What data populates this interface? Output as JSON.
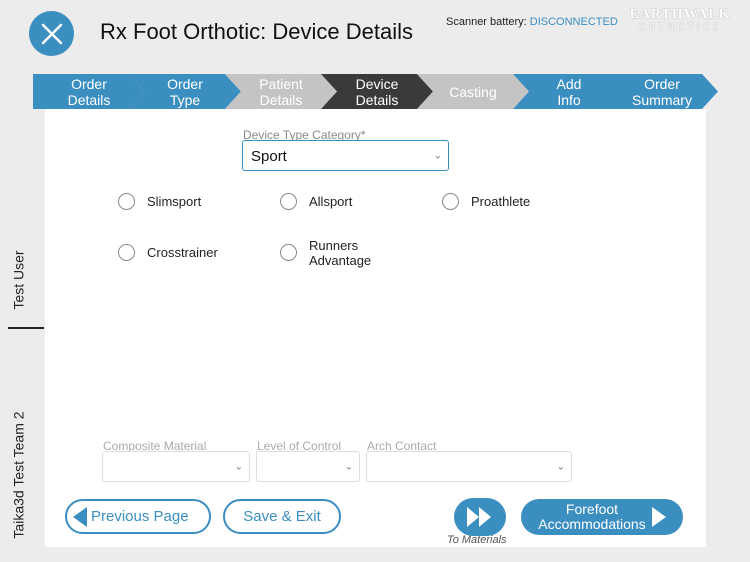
{
  "header": {
    "title": "Rx Foot Orthotic: Device Details",
    "battery_label": "Scanner battery:",
    "battery_status": "DISCONNECTED",
    "logo_line1": "EARTHWALK",
    "logo_line2": "ORTHOTICS",
    "close_icon": "close-icon"
  },
  "steps": [
    {
      "line1": "Order",
      "line2": "Details",
      "state": "done"
    },
    {
      "line1": "Order",
      "line2": "Type",
      "state": "done"
    },
    {
      "line1": "Patient",
      "line2": "Details",
      "state": "pending"
    },
    {
      "line1": "Device",
      "line2": "Details",
      "state": "current"
    },
    {
      "line1": "Casting",
      "line2": "",
      "state": "pending"
    },
    {
      "line1": "Add",
      "line2": "Info",
      "state": "done"
    },
    {
      "line1": "Order",
      "line2": "Summary",
      "state": "done"
    }
  ],
  "sidebar": {
    "user": "Test User",
    "team": "Taika3d Test Team 2"
  },
  "form": {
    "device_type_label": "Device Type Category*",
    "device_type_value": "Sport",
    "options": [
      "Slimsport",
      "Allsport",
      "Proathlete",
      "Crosstrainer",
      "Runners",
      "Advantage"
    ],
    "composite_label": "Composite Material",
    "level_label": "Level of Control",
    "arch_label": "Arch Contact"
  },
  "footer": {
    "previous": "Previous Page",
    "save_exit": "Save & Exit",
    "to_materials": "To Materials",
    "forefoot_line1": "Forefoot",
    "forefoot_line2": "Accommodations"
  },
  "colors": {
    "accent": "#3b8ec0",
    "step_current": "#3a3a3a",
    "step_pending": "#c4c4c4"
  }
}
